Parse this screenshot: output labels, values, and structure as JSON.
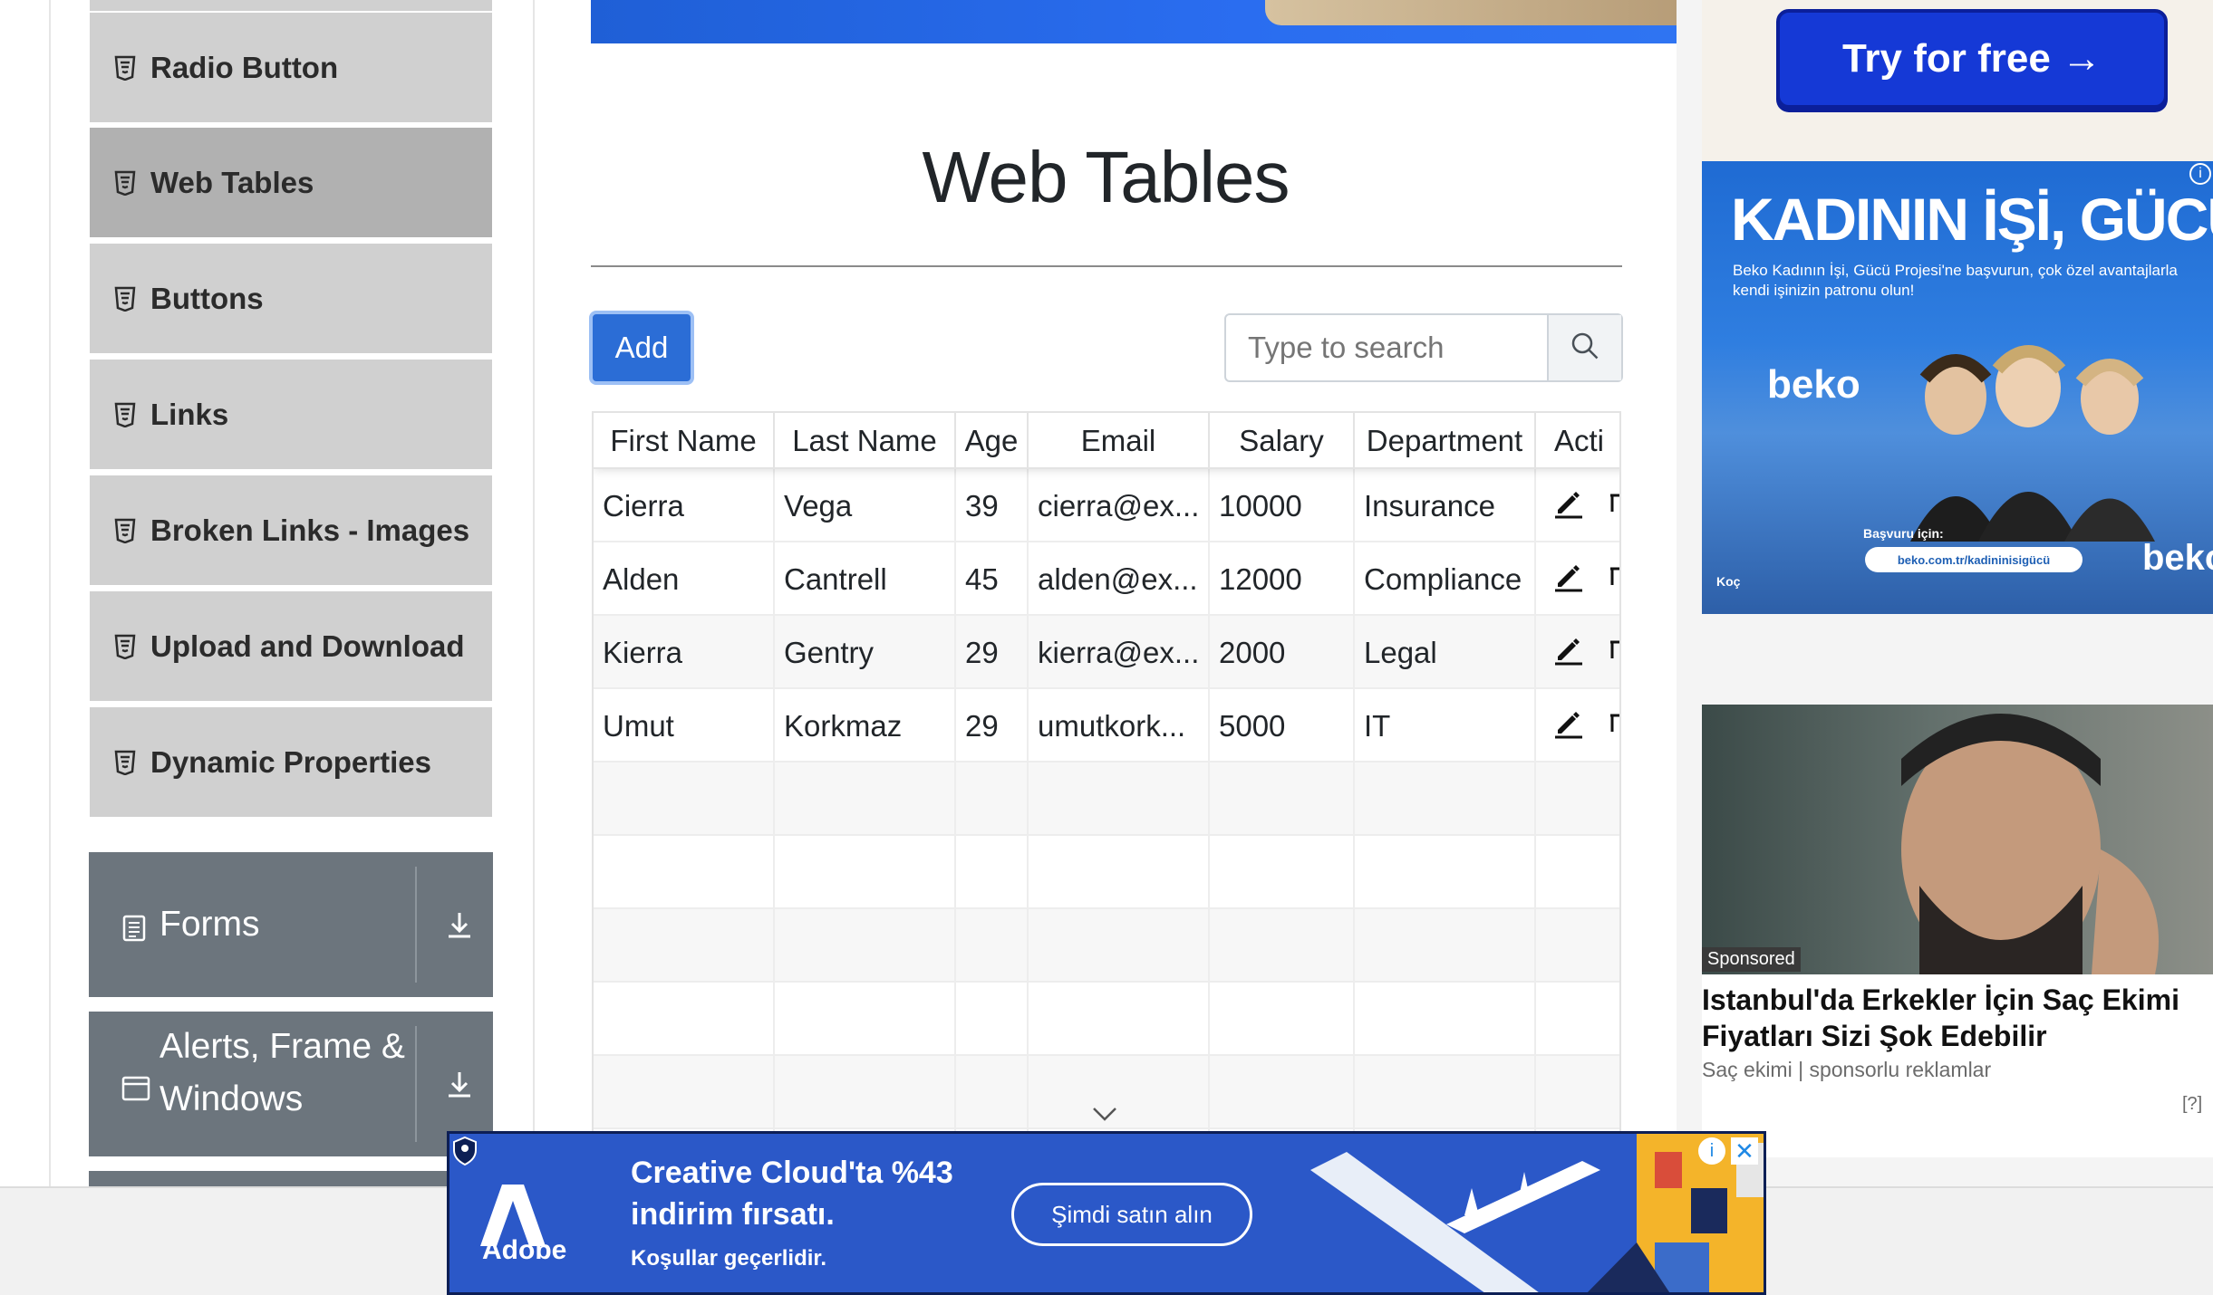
{
  "sidebar": {
    "items": [
      {
        "label": "Radio Button",
        "icon": "html5-icon",
        "active": false
      },
      {
        "label": "Web Tables",
        "icon": "html5-icon",
        "active": true
      },
      {
        "label": "Buttons",
        "icon": "html5-icon",
        "active": false
      },
      {
        "label": "Links",
        "icon": "html5-icon",
        "active": false
      },
      {
        "label": "Broken Links - Images",
        "icon": "html5-icon",
        "active": false
      },
      {
        "label": "Upload and Download",
        "icon": "html5-icon",
        "active": false
      },
      {
        "label": "Dynamic Properties",
        "icon": "html5-icon",
        "active": false
      }
    ],
    "groups": [
      {
        "label": "Forms",
        "icon": "document-icon"
      },
      {
        "label": "Alerts, Frame &",
        "label_line2": "Windows",
        "icon": "window-icon"
      }
    ]
  },
  "main": {
    "title": "Web Tables",
    "add_label": "Add",
    "search_placeholder": "Type to search"
  },
  "table": {
    "headers": [
      "First Name",
      "Last Name",
      "Age",
      "Email",
      "Salary",
      "Department",
      "Acti"
    ],
    "rows": [
      [
        "Cierra",
        "Vega",
        "39",
        "cierra@ex...",
        "10000",
        "Insurance"
      ],
      [
        "Alden",
        "Cantrell",
        "45",
        "alden@ex...",
        "12000",
        "Compliance"
      ],
      [
        "Kierra",
        "Gentry",
        "29",
        "kierra@ex...",
        "2000",
        "Legal"
      ],
      [
        "Umut",
        "Korkmaz",
        "29",
        "umutkork...",
        "5000",
        "IT"
      ]
    ]
  },
  "ads": {
    "try_label": "Try for free →",
    "beko": {
      "headline": "KADININ İŞİ, GÜCÜ!",
      "sub": "Beko Kadının İşi, Gücü Projesi'ne başvurun, çok özel avantajlarla kendi işinizin patronu olun!",
      "logo": "beko",
      "apply": "Başvuru için:",
      "url": "beko.com.tr/kadininisigücü",
      "koc": "Koç",
      "info": "i"
    },
    "sponsored": {
      "badge": "Sponsored",
      "title": "Istanbul'da Erkekler İçin Saç Ekimi Fiyatları Sizi Şok Edebilir",
      "source": "Saç ekimi | sponsorlu reklamlar",
      "help": "[?]"
    },
    "adobe": {
      "line1": "Creative Cloud'ta %43",
      "line2": "indirim fırsatı.",
      "line3": "Koşullar geçerlidir.",
      "cta": "Şimdi satın alın",
      "brand": "Adobe",
      "close": "✕",
      "info": "i"
    }
  },
  "colors": {
    "add_button": "#2b6dd6",
    "sidebar_item": "#d0d0d0",
    "sidebar_active": "#b1b1b1",
    "group_header": "#6c757d"
  }
}
